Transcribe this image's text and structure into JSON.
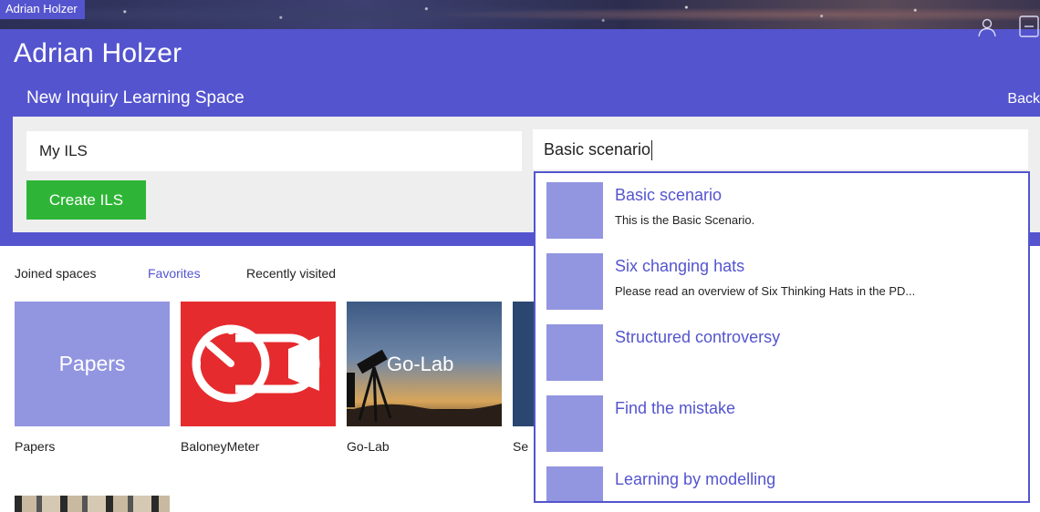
{
  "top_strip": {
    "label": "Adrian Holzer"
  },
  "header": {
    "title": "Adrian Holzer",
    "subtitle": "New Inquiry Learning Space",
    "back_label": "Back"
  },
  "create": {
    "name_value": "My ILS",
    "button_label": "Create ILS",
    "scenario_value": "Basic scenario"
  },
  "tabs": [
    {
      "label": "Joined spaces",
      "active": false
    },
    {
      "label": "Favorites",
      "active": true
    },
    {
      "label": "Recently visited",
      "active": false
    }
  ],
  "tiles": [
    {
      "label": "Papers",
      "thumb_text": "Papers"
    },
    {
      "label": "BaloneyMeter"
    },
    {
      "label": "Go-Lab",
      "thumb_text": "Go-Lab"
    },
    {
      "label": "Se"
    }
  ],
  "scenarios": [
    {
      "title": "Basic scenario",
      "description": "This is the Basic Scenario."
    },
    {
      "title": "Six changing hats",
      "description": "Please read an overview of Six Thinking Hats in the PD..."
    },
    {
      "title": "Structured controversy",
      "description": ""
    },
    {
      "title": "Find the mistake",
      "description": ""
    },
    {
      "title": "Learning by modelling",
      "description": ""
    }
  ],
  "colors": {
    "brand": "#5454cf",
    "accent_green": "#2eb537",
    "thumb": "#9295e0",
    "baloney_red": "#e52b2e"
  },
  "icons": {
    "user": "user-icon",
    "logout": "logout-icon"
  }
}
